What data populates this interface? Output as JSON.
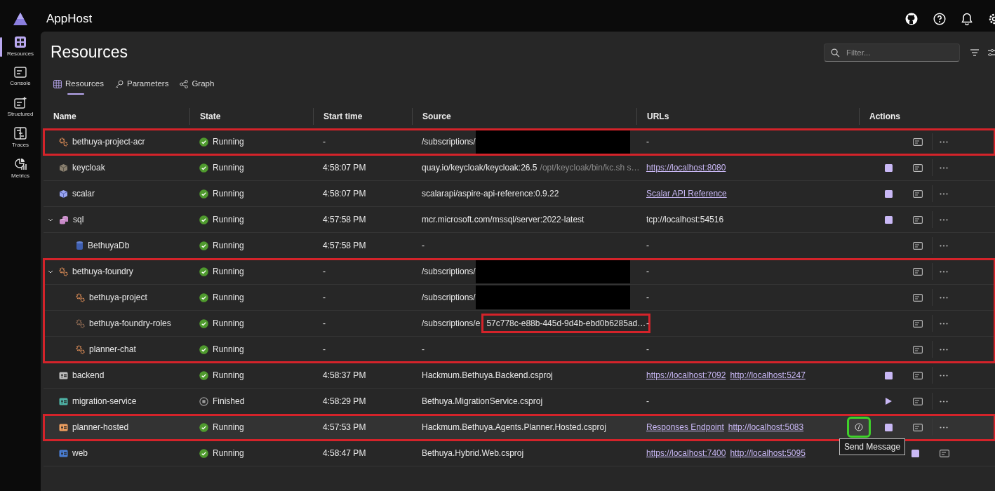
{
  "app": {
    "title": "AppHost"
  },
  "sidebar": {
    "items": [
      {
        "label": "Resources",
        "kind": "grid",
        "selected": true
      },
      {
        "label": "Console",
        "kind": "console",
        "selected": false
      },
      {
        "label": "Structured",
        "kind": "structured",
        "selected": false
      },
      {
        "label": "Traces",
        "kind": "traces",
        "selected": false
      },
      {
        "label": "Metrics",
        "kind": "metrics",
        "selected": false
      }
    ]
  },
  "page": {
    "title": "Resources"
  },
  "filter": {
    "placeholder": "Filter..."
  },
  "tabs": [
    {
      "label": "Resources",
      "kind": "grid",
      "selected": true
    },
    {
      "label": "Parameters",
      "kind": "key",
      "selected": false
    },
    {
      "label": "Graph",
      "kind": "graph",
      "selected": false
    }
  ],
  "table": {
    "columns": [
      "Name",
      "State",
      "Start time",
      "Source",
      "URLs",
      "Actions"
    ],
    "groups": [
      {
        "outlined": true,
        "rows": [
          {
            "name": "bethuya-project-acr",
            "kind": "azure",
            "selected": false,
            "state": {
              "kind": "running",
              "label": "Running"
            },
            "start": "-",
            "source": {
              "text": "/subscriptions/",
              "redacted": true
            },
            "urls": [
              {
                "text": "-",
                "link": false
              }
            ],
            "actions": [
              {
                "kind": "console"
              },
              {
                "kind": "more"
              }
            ]
          }
        ]
      },
      {
        "outlined": false,
        "rows": [
          {
            "name": "keycloak",
            "kind": "container",
            "selected": false,
            "state": {
              "kind": "running",
              "label": "Running"
            },
            "start": "4:58:07 PM",
            "source": {
              "text": "quay.io/keycloak/keycloak:26.5",
              "args": "/opt/keycloak/bin/kc.sh s…"
            },
            "urls": [
              {
                "text": "https://localhost:8080",
                "link": true
              }
            ],
            "actions": [
              {
                "kind": "stop"
              },
              {
                "kind": "console"
              },
              {
                "kind": "more"
              }
            ]
          },
          {
            "name": "scalar",
            "kind": "container-blue",
            "selected": false,
            "state": {
              "kind": "running",
              "label": "Running"
            },
            "start": "4:58:07 PM",
            "source": {
              "text": "scalarapi/aspire-api-reference:0.9.22"
            },
            "urls": [
              {
                "text": "Scalar API Reference",
                "link": true
              }
            ],
            "actions": [
              {
                "kind": "stop"
              },
              {
                "kind": "console"
              },
              {
                "kind": "more"
              }
            ]
          },
          {
            "name": "sql",
            "kind": "sql",
            "selected": false,
            "expanded": true,
            "state": {
              "kind": "running",
              "label": "Running"
            },
            "start": "4:57:58 PM",
            "source": {
              "text": "mcr.microsoft.com/mssql/server:2022-latest"
            },
            "urls": [
              {
                "text": "tcp://localhost:54516",
                "link": false
              }
            ],
            "actions": [
              {
                "kind": "stop"
              },
              {
                "kind": "console"
              },
              {
                "kind": "more"
              }
            ],
            "children": [
              {
                "name": "BethuyaDb",
                "kind": "database",
                "selected": false,
                "state": {
                  "kind": "running",
                  "label": "Running"
                },
                "start": "4:57:58 PM",
                "source": {
                  "text": "-"
                },
                "urls": [
                  {
                    "text": "-",
                    "link": false
                  }
                ],
                "actions": [
                  {
                    "kind": "console"
                  },
                  {
                    "kind": "more"
                  }
                ]
              }
            ]
          }
        ]
      },
      {
        "outlined": true,
        "rows": [
          {
            "name": "bethuya-foundry",
            "kind": "azure",
            "selected": false,
            "expanded": true,
            "state": {
              "kind": "running",
              "label": "Running"
            },
            "start": "-",
            "source": {
              "text": "/subscriptions/",
              "redacted": true
            },
            "urls": [
              {
                "text": "-",
                "link": false
              }
            ],
            "actions": [
              {
                "kind": "console"
              },
              {
                "kind": "more"
              }
            ],
            "children": [
              {
                "name": "bethuya-project",
                "kind": "azure",
                "selected": false,
                "state": {
                  "kind": "running",
                  "label": "Running"
                },
                "start": "-",
                "source": {
                  "text": "/subscriptions/",
                  "redacted": true
                },
                "urls": [
                  {
                    "text": "-",
                    "link": false
                  }
                ],
                "actions": [
                  {
                    "kind": "console"
                  },
                  {
                    "kind": "more"
                  }
                ]
              },
              {
                "name": "bethuya-foundry-roles",
                "kind": "azure-dim",
                "selected": false,
                "state": {
                  "kind": "running",
                  "label": "Running"
                },
                "start": "-",
                "source": {
                  "text": "/subscriptions/e",
                  "boxed": "57c778c-e88b-445d-9d4b-ebd0b6285ad…"
                },
                "urls": [
                  {
                    "text": "-",
                    "link": false
                  }
                ],
                "actions": [
                  {
                    "kind": "console"
                  },
                  {
                    "kind": "more"
                  }
                ]
              },
              {
                "name": "planner-chat",
                "kind": "azure",
                "selected": false,
                "state": {
                  "kind": "running",
                  "label": "Running"
                },
                "start": "-",
                "source": {
                  "text": "-"
                },
                "urls": [
                  {
                    "text": "-",
                    "link": false
                  }
                ],
                "actions": [
                  {
                    "kind": "console"
                  },
                  {
                    "kind": "more"
                  }
                ]
              }
            ]
          }
        ]
      },
      {
        "outlined": false,
        "rows": [
          {
            "name": "backend",
            "kind": "project",
            "color": "#bdbdbd",
            "selected": false,
            "state": {
              "kind": "running",
              "label": "Running"
            },
            "start": "4:58:37 PM",
            "source": {
              "text": "Hackmum.Bethuya.Backend.csproj"
            },
            "urls": [
              {
                "text": "https://localhost:7092",
                "link": true
              },
              {
                "text": "http://localhost:5247",
                "link": true
              }
            ],
            "actions": [
              {
                "kind": "stop"
              },
              {
                "kind": "console"
              },
              {
                "kind": "more"
              }
            ]
          },
          {
            "name": "migration-service",
            "kind": "project",
            "color": "#4fb3a6",
            "selected": false,
            "state": {
              "kind": "finished",
              "label": "Finished"
            },
            "start": "4:58:29 PM",
            "source": {
              "text": "Bethuya.MigrationService.csproj"
            },
            "urls": [
              {
                "text": "-",
                "link": false
              }
            ],
            "actions": [
              {
                "kind": "start"
              },
              {
                "kind": "console"
              },
              {
                "kind": "more"
              }
            ]
          }
        ]
      },
      {
        "outlined": true,
        "rows": [
          {
            "name": "planner-hosted",
            "kind": "project",
            "color": "#f0a060",
            "selected": true,
            "state": {
              "kind": "running",
              "label": "Running"
            },
            "start": "4:57:53 PM",
            "source": {
              "text": "Hackmum.Bethuya.Agents.Planner.Hosted.csproj"
            },
            "urls": [
              {
                "text": "Responses Endpoint",
                "link": true
              },
              {
                "text": "http://localhost:5083",
                "link": true
              }
            ],
            "actions": [
              {
                "kind": "send",
                "highlighted": true,
                "tooltip": "Send Message"
              },
              {
                "kind": "stop"
              },
              {
                "kind": "console"
              },
              {
                "kind": "more"
              }
            ]
          }
        ]
      },
      {
        "outlined": false,
        "rows": [
          {
            "name": "web",
            "kind": "project",
            "color": "#4a7fd6",
            "selected": false,
            "state": {
              "kind": "running",
              "label": "Running"
            },
            "start": "4:58:47 PM",
            "source": {
              "text": "Bethuya.Hybrid.Web.csproj"
            },
            "urls": [
              {
                "text": "https://localhost:7400",
                "link": true
              },
              {
                "text": "http://localhost:5095",
                "link": true
              }
            ],
            "actions": [
              {
                "kind": "stop"
              },
              {
                "kind": "console"
              }
            ]
          }
        ]
      }
    ]
  }
}
